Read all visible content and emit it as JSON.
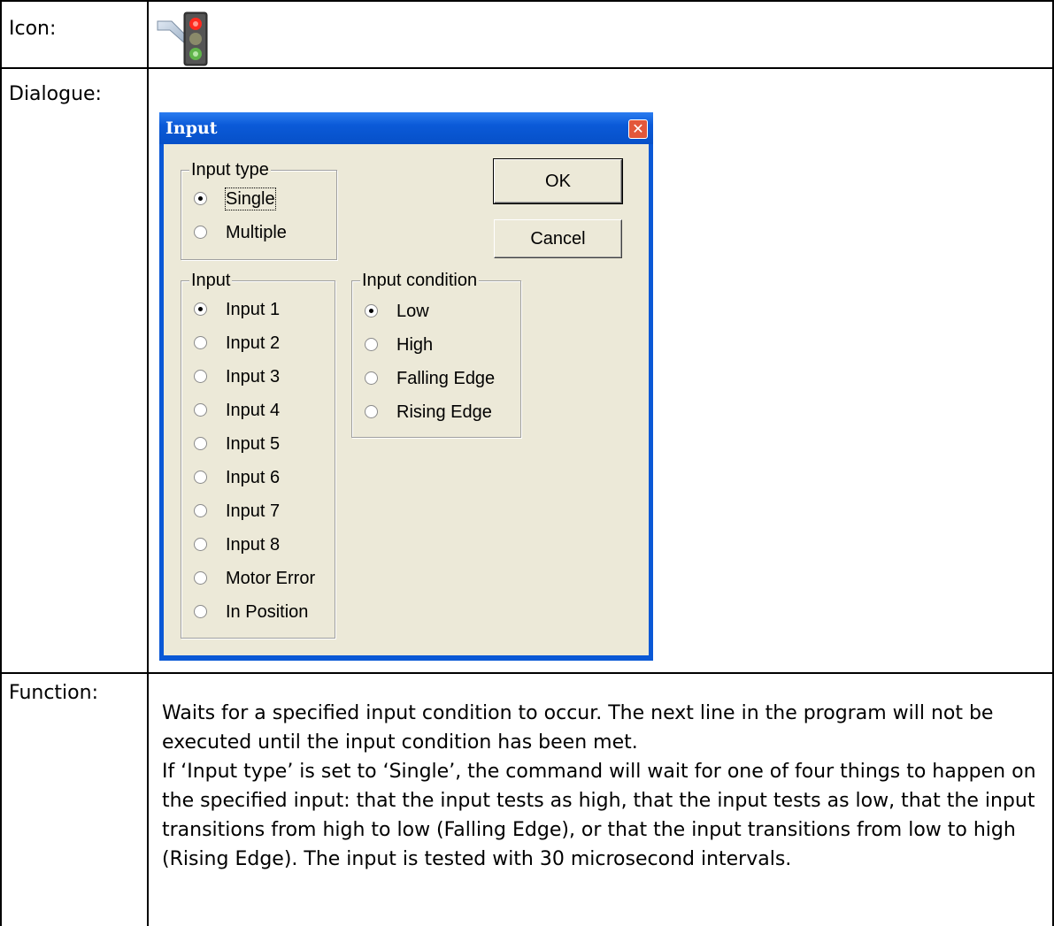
{
  "table": {
    "icon_label": "Icon:",
    "dialogue_label": "Dialogue:",
    "function_label": "Function:"
  },
  "icon": {
    "name": "traffic-light-icon"
  },
  "dialog": {
    "title": "Input",
    "close_glyph": "✕",
    "ok_label": "OK",
    "cancel_label": "Cancel",
    "input_type": {
      "label": "Input type",
      "options": [
        {
          "label": "Single",
          "checked": true
        },
        {
          "label": "Multiple",
          "checked": false
        }
      ]
    },
    "input": {
      "label": "Input",
      "options": [
        {
          "label": "Input 1",
          "checked": true
        },
        {
          "label": "Input 2",
          "checked": false
        },
        {
          "label": "Input 3",
          "checked": false
        },
        {
          "label": "Input 4",
          "checked": false
        },
        {
          "label": "Input 5",
          "checked": false
        },
        {
          "label": "Input 6",
          "checked": false
        },
        {
          "label": "Input 7",
          "checked": false
        },
        {
          "label": "Input 8",
          "checked": false
        },
        {
          "label": "Motor Error",
          "checked": false
        },
        {
          "label": "In Position",
          "checked": false
        }
      ]
    },
    "input_condition": {
      "label": "Input condition",
      "options": [
        {
          "label": "Low",
          "checked": true
        },
        {
          "label": "High",
          "checked": false
        },
        {
          "label": "Falling Edge",
          "checked": false
        },
        {
          "label": "Rising Edge",
          "checked": false
        }
      ]
    }
  },
  "function_text": {
    "para1": "Waits for a specified input condition to occur. The next line in the program will not be executed until the input condition has been met.",
    "para2": "If ‘Input type’ is set to ‘Single’, the command will wait for one of four things to happen on the specified input: that the input tests as high, that the input tests as low, that the input transitions from high to low (Falling Edge), or that the input transitions from low to high (Rising Edge). The input is tested with 30 microsecond intervals."
  },
  "colors": {
    "titlebar": "#0a58d6",
    "dialog_face": "#ece9d8",
    "close_button": "#e3573a"
  }
}
